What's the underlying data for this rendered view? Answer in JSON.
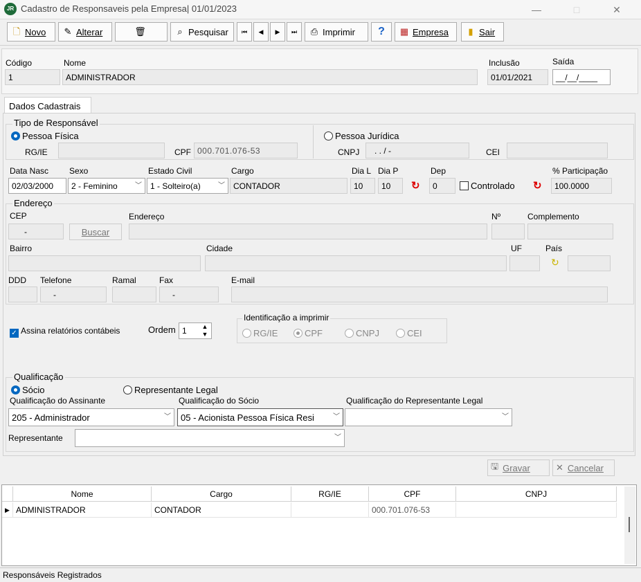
{
  "window": {
    "title": "Cadastro de Responsaveis pela Empresa| 01/01/2023",
    "logo": "JR",
    "minimize": "—",
    "maximize": "□",
    "close": "✕"
  },
  "toolbar": {
    "novo": "Novo",
    "alterar": "Alterar",
    "pesquisar": "Pesquisar",
    "first": "⏮",
    "prev": "◀",
    "next": "▶",
    "last": "⏭",
    "imprimir": "Imprimir",
    "help": "?",
    "empresa": "Empresa",
    "sair": "Sair"
  },
  "header": {
    "codigo_label": "Código",
    "codigo": "1",
    "nome_label": "Nome",
    "nome": "ADMINISTRADOR",
    "inclusao_label": "Inclusão",
    "inclusao": "01/01/2021",
    "saida_label": "Saída",
    "saida": "__/__/____"
  },
  "tabs": {
    "dados": "Dados Cadastrais"
  },
  "tipo": {
    "title": "Tipo de Responsável",
    "fisica": "Pessoa Física",
    "juridica": "Pessoa Jurídica",
    "rgie_label": "RG/IE",
    "rgie": "",
    "cpf_label": "CPF",
    "cpf": "000.701.076-53",
    "cnpj_label": "CNPJ",
    "cnpj": ". . / -",
    "cei_label": "CEI",
    "cei": ""
  },
  "pessoal": {
    "datanasc_label": "Data Nasc",
    "datanasc": "02/03/2000",
    "sexo_label": "Sexo",
    "sexo": "2 - Feminino",
    "estcivil_label": "Estado Civil",
    "estcivil": "1 - Solteiro(a)",
    "cargo_label": "Cargo",
    "cargo": "CONTADOR",
    "dial_label": "Dia L",
    "dial": "10",
    "diap_label": "Dia P",
    "diap": "10",
    "dep_label": "Dep",
    "dep": "0",
    "controlado": "Controlado",
    "participacao_label": "% Participação",
    "participacao": "100.0000"
  },
  "endereco": {
    "title": "Endereço",
    "cep_label": "CEP",
    "cep": "-",
    "buscar": "Buscar",
    "endereco_label": "Endereço",
    "num_label": "Nº",
    "complemento_label": "Complemento",
    "bairro_label": "Bairro",
    "cidade_label": "Cidade",
    "uf_label": "UF",
    "pais_label": "País",
    "ddd_label": "DDD",
    "telefone_label": "Telefone",
    "telefone": "-",
    "ramal_label": "Ramal",
    "fax_label": "Fax",
    "fax": "-",
    "email_label": "E-mail"
  },
  "assina": {
    "label": "Assina relatórios contábeis",
    "ordem_label": "Ordem",
    "ordem": "1",
    "ident_title": "Identificação a imprimir",
    "opt_rgie": "RG/IE",
    "opt_cpf": "CPF",
    "opt_cnpj": "CNPJ",
    "opt_cei": "CEI"
  },
  "qualificacao": {
    "title": "Qualificação",
    "socio": "Sócio",
    "representante_legal": "Representante Legal",
    "assinante_label": "Qualificação do Assinante",
    "assinante": "205 - Administrador",
    "socio_label": "Qualificação do Sócio",
    "socio_value": "05 - Acionista Pessoa Física Resi",
    "replegal_label": "Qualificação do Representante Legal",
    "replegal_value": "",
    "representante_label": "Representante",
    "representante": ""
  },
  "actions": {
    "gravar": "Gravar",
    "cancelar": "Cancelar"
  },
  "grid": {
    "columns": [
      "Nome",
      "Cargo",
      "RG/IE",
      "CPF",
      "CNPJ"
    ],
    "rows": [
      [
        "ADMINISTRADOR",
        "CONTADOR",
        "",
        "000.701.076-53",
        ""
      ]
    ]
  },
  "status": {
    "text": "Responsáveis Registrados"
  }
}
